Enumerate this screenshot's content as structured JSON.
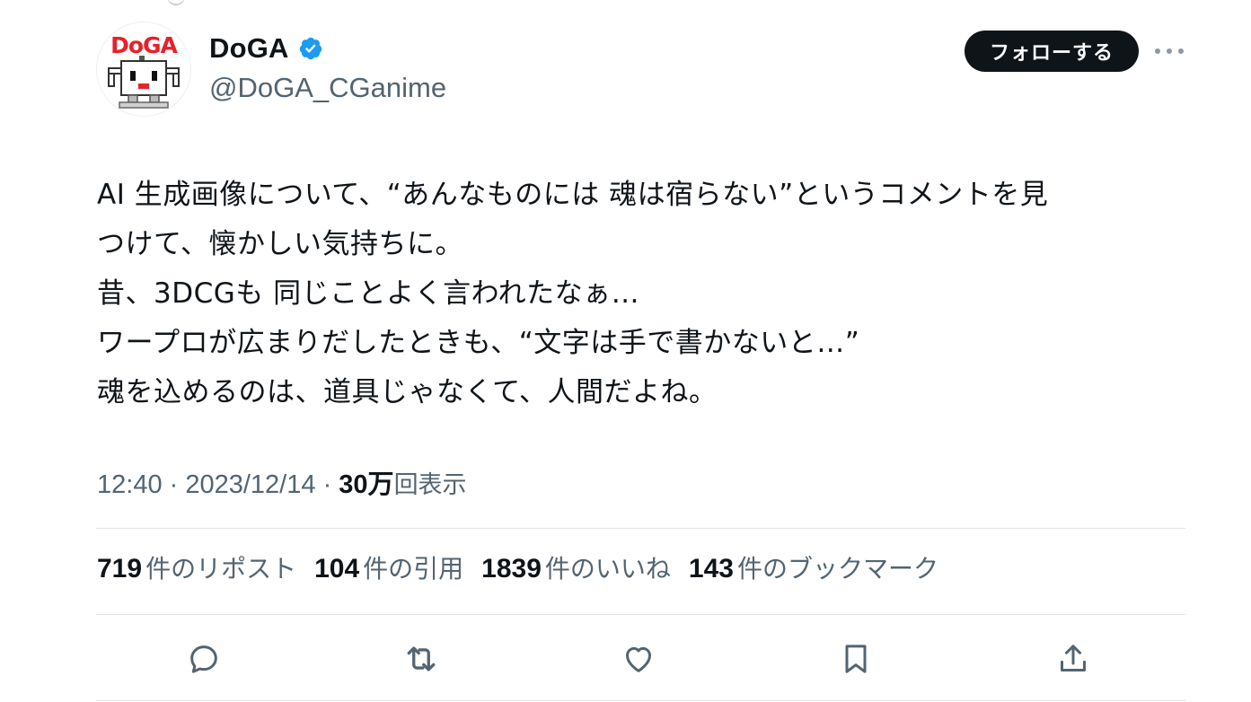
{
  "author": {
    "display_name": "DoGA",
    "handle": "@DoGA_CGanime",
    "avatar_logo_text": "DoGA",
    "verified": true
  },
  "follow_label": "フォローする",
  "tweet": {
    "lines": [
      "AI 生成画像について、“あんなものには 魂は宿らない”というコメントを見",
      "つけて、懐かしい気持ちに。",
      "昔、3DCGも 同じことよく言われたなぁ…",
      "ワープロが広まりだしたときも、“文字は手で書かないと…”",
      "魂を込めるのは、道具じゃなくて、人間だよね。"
    ]
  },
  "meta": {
    "time": "12:40",
    "sep1": " · ",
    "date": "2023/12/14",
    "sep2": " · ",
    "views_count": "30万",
    "views_label": "回表示"
  },
  "stats": [
    {
      "count": "719",
      "label": "件のリポスト"
    },
    {
      "count": "104",
      "label": "件の引用"
    },
    {
      "count": "1839",
      "label": "件のいいね"
    },
    {
      "count": "143",
      "label": "件のブックマーク"
    }
  ],
  "actions": [
    "reply-icon",
    "repost-icon",
    "like-icon",
    "bookmark-icon",
    "share-icon"
  ],
  "colors": {
    "text": "#0f1419",
    "secondary": "#536471",
    "verified": "#1d9bf0",
    "divider": "#e1e6ea",
    "logo_red": "#e8202a"
  }
}
